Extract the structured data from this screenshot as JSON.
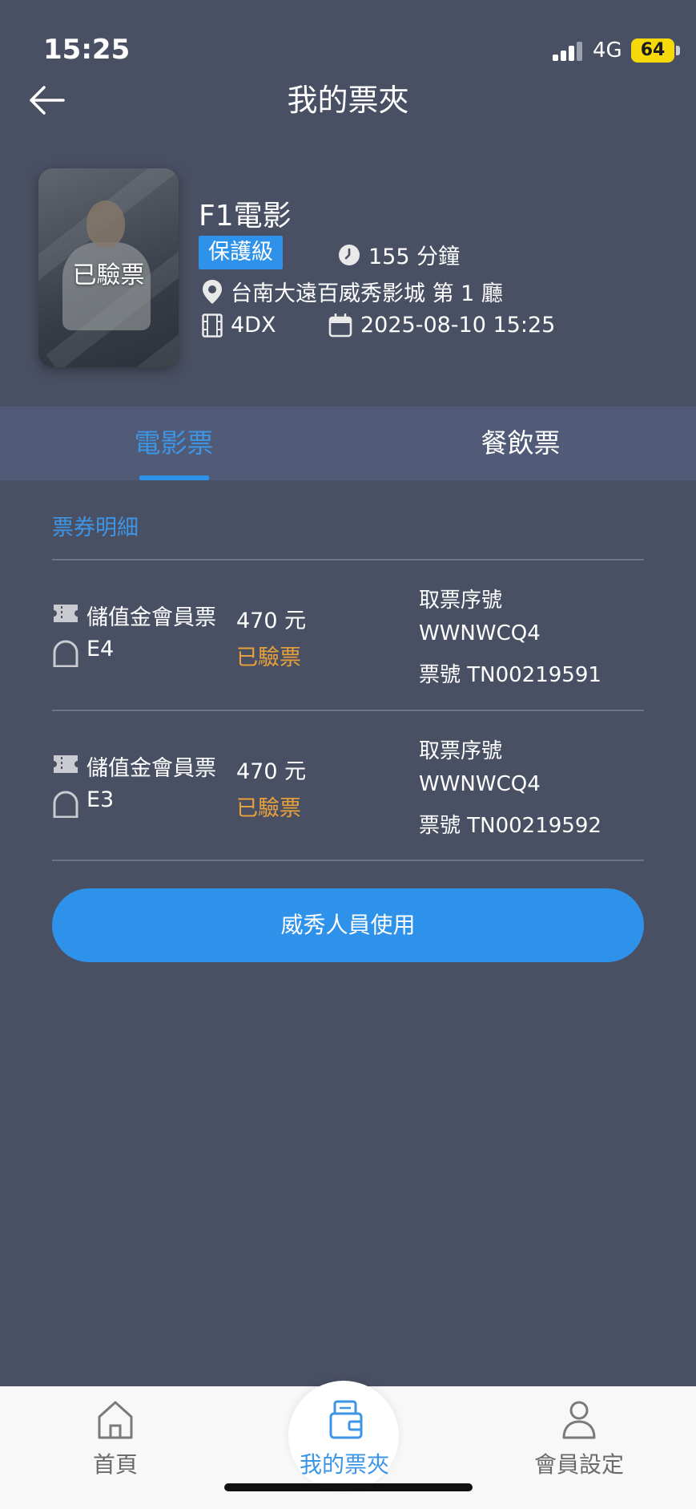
{
  "status_bar": {
    "time": "15:25",
    "network": "4G",
    "battery": "64"
  },
  "header": {
    "title": "我的票夾"
  },
  "movie": {
    "poster_status": "已驗票",
    "title": "F1電影",
    "rating": "保護級",
    "duration": "155 分鐘",
    "cinema": "台南大遠百威秀影城 第 1 廳",
    "format": "4DX",
    "showtime": "2025-08-10 15:25"
  },
  "tabs": [
    {
      "label": "電影票",
      "active": true
    },
    {
      "label": "餐飲票",
      "active": false
    }
  ],
  "section_title": "票券明細",
  "tickets": [
    {
      "type": "儲值金會員票",
      "seat": "E4",
      "price": "470 元",
      "status": "已驗票",
      "pickup_label": "取票序號",
      "pickup_code": "WWNWCQ4",
      "ticket_no": "票號 TN00219591"
    },
    {
      "type": "儲值金會員票",
      "seat": "E3",
      "price": "470 元",
      "status": "已驗票",
      "pickup_label": "取票序號",
      "pickup_code": "WWNWCQ4",
      "ticket_no": "票號 TN00219592"
    }
  ],
  "staff_button": "威秀人員使用",
  "bottom_nav": [
    {
      "label": "首頁",
      "icon": "home-icon",
      "active": false
    },
    {
      "label": "我的票夾",
      "icon": "wallet-icon",
      "active": true
    },
    {
      "label": "會員設定",
      "icon": "person-icon",
      "active": false
    }
  ],
  "colors": {
    "background": "#4a5063",
    "accent": "#2e91ea",
    "checked_status": "#e8a03a",
    "tab_bar": "#515a76"
  }
}
